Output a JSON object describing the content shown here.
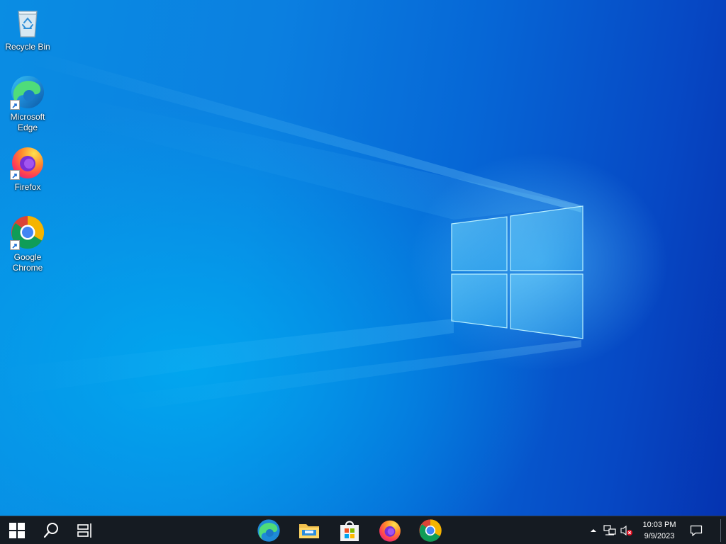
{
  "desktop": {
    "icons": [
      {
        "label": "Recycle Bin",
        "icon": "recycle-bin-icon"
      },
      {
        "label": "Microsoft\nEdge",
        "icon": "edge-icon"
      },
      {
        "label": "Firefox",
        "icon": "firefox-icon"
      },
      {
        "label": "Google\nChrome",
        "icon": "chrome-icon"
      }
    ]
  },
  "taskbar": {
    "start": {
      "icon": "windows-start-icon"
    },
    "search": {
      "icon": "search-icon"
    },
    "task_view": {
      "icon": "task-view-icon"
    },
    "pinned": [
      {
        "app": "Microsoft Edge",
        "icon": "edge-icon"
      },
      {
        "app": "File Explorer",
        "icon": "file-explorer-icon"
      },
      {
        "app": "Microsoft Store",
        "icon": "store-icon"
      },
      {
        "app": "Firefox",
        "icon": "firefox-icon"
      },
      {
        "app": "Google Chrome",
        "icon": "chrome-icon"
      }
    ],
    "tray": {
      "overflow_icon": "chevron-up-icon",
      "network_icon": "network-icon",
      "volume_icon": "volume-muted-icon",
      "time": "10:03 PM",
      "date": "9/9/2023",
      "notification_icon": "action-center-icon"
    }
  },
  "colors": {
    "taskbar_bg": "#151b22",
    "wallpaper_primary": "#0b7fe0",
    "wallpaper_dark": "#0533b0",
    "logo_pane": "#5fd3ff"
  }
}
